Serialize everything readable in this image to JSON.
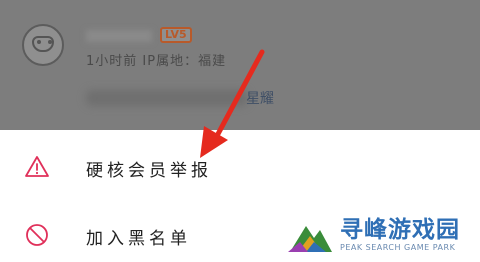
{
  "background": {
    "level_badge": "LV5",
    "meta_line": "1小时前  IP属地：福建",
    "comment_tail": "星耀"
  },
  "sheet": {
    "items": [
      {
        "label": "硬核会员举报",
        "icon": "warning-triangle-icon",
        "icon_color": "#e0305a"
      },
      {
        "label": "加入黑名单",
        "icon": "block-circle-icon",
        "icon_color": "#e0305a"
      }
    ]
  },
  "watermark": {
    "title": "寻峰游戏园",
    "subtitle": "PEAK SEARCH GAME PARK"
  },
  "colors": {
    "accent_red": "#e0305a",
    "arrow_red": "#e52a1e",
    "watermark_blue": "#2f6fb5"
  }
}
